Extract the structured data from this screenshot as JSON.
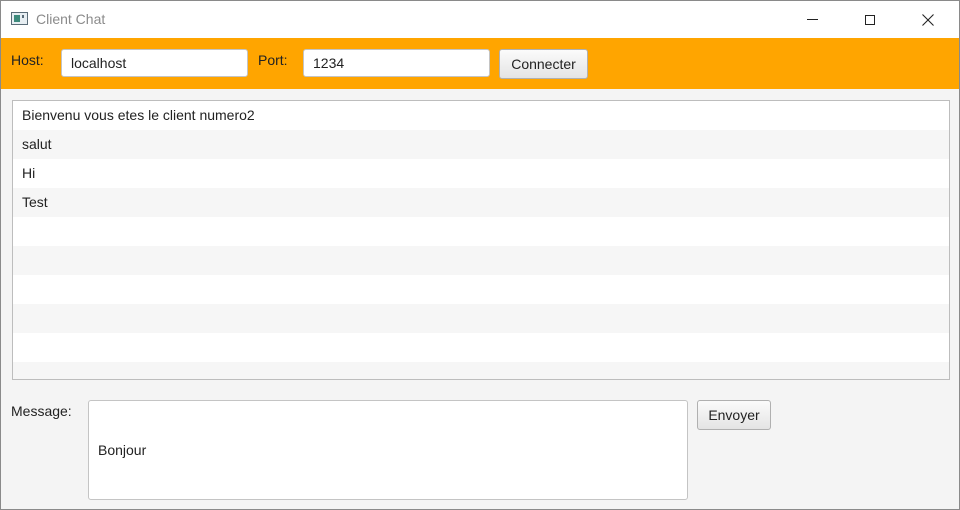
{
  "window": {
    "title": "Client Chat",
    "icon": "java-app-icon"
  },
  "toolbar": {
    "host_label": "Host:",
    "host_value": "localhost",
    "port_label": "Port:",
    "port_value": "1234",
    "connect_label": "Connecter",
    "background_color": "#ffa500"
  },
  "chat": {
    "messages": [
      "Bienvenu vous etes le client numero2",
      "salut",
      "Hi",
      "Test",
      "",
      "",
      "",
      "",
      "",
      ""
    ]
  },
  "composer": {
    "message_label": "Message:",
    "message_value": "Bonjour",
    "send_label": "Envoyer"
  }
}
